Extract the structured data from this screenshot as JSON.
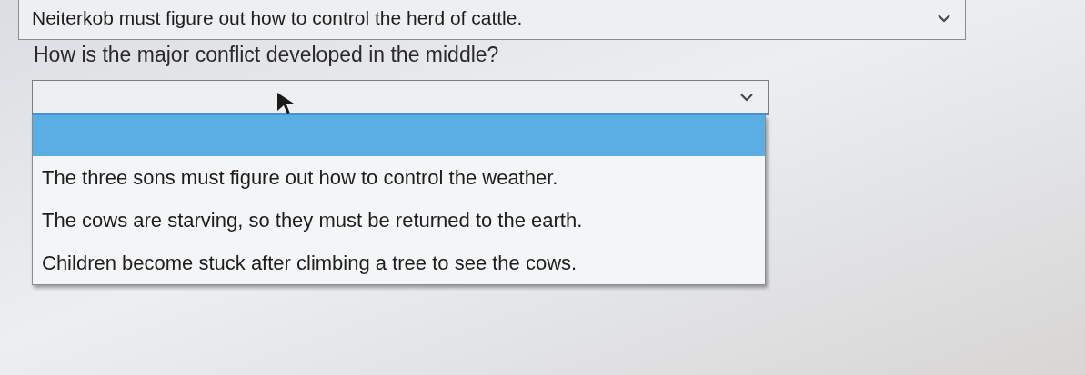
{
  "previous_dropdown": {
    "value": "Neiterkob must figure out how to control the herd of cattle.",
    "expanded": false
  },
  "question": "How is the major conflict developed in the middle?",
  "dropdown": {
    "expanded": true,
    "options": [
      {
        "kind": "blank",
        "selected": true
      },
      {
        "kind": "text",
        "label": "The three sons must figure out how to control the weather.",
        "selected": false
      },
      {
        "kind": "text",
        "label": "The cows are starving, so they must be returned to the earth.",
        "selected": false
      },
      {
        "kind": "text",
        "label": "Children become stuck after climbing a tree to see the cows.",
        "selected": false
      }
    ]
  }
}
